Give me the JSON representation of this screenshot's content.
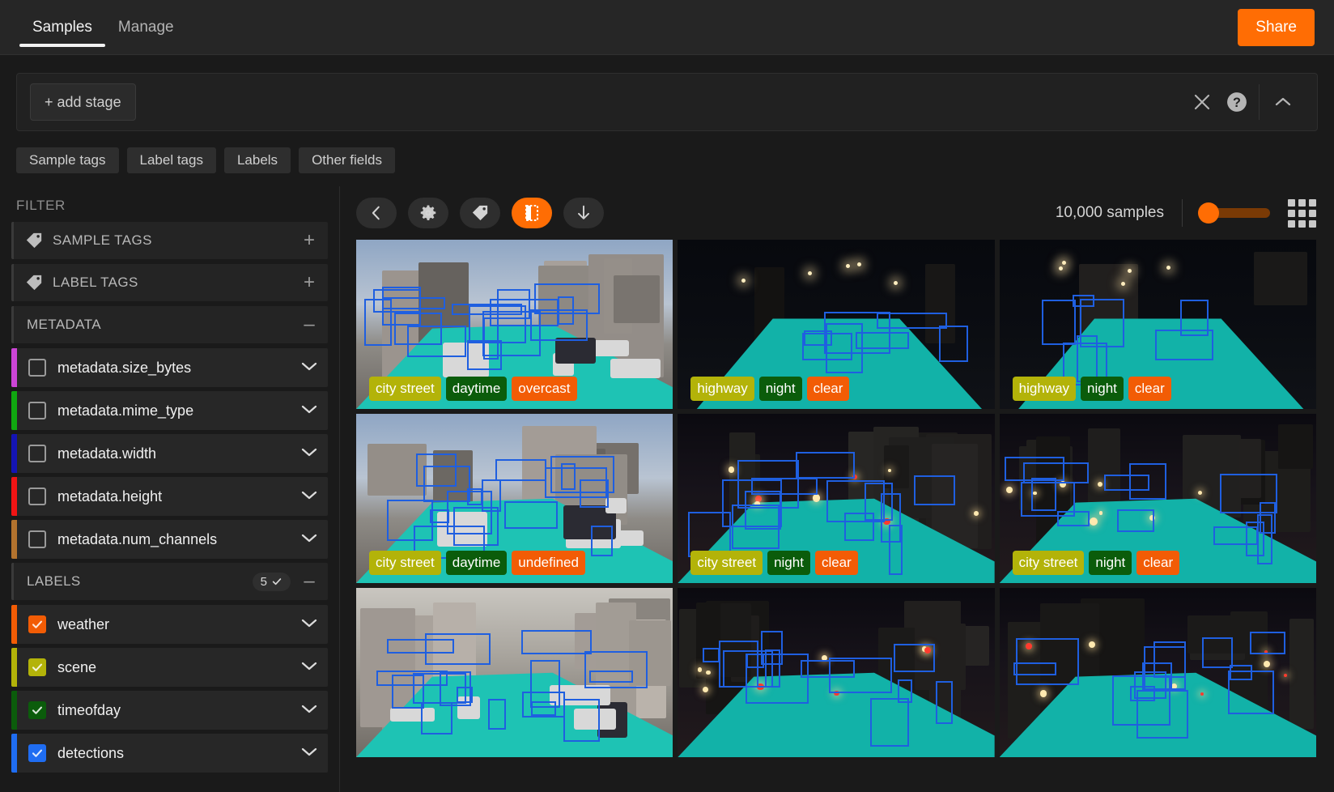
{
  "topnav": {
    "tabs": [
      {
        "label": "Samples",
        "active": true
      },
      {
        "label": "Manage",
        "active": false
      }
    ],
    "share_label": "Share"
  },
  "stagebar": {
    "add_stage_label": "+ add stage",
    "close_icon": "close-icon",
    "help_icon": "help-icon",
    "collapse_icon": "chevron-up-icon"
  },
  "fieldtabs": [
    {
      "label": "Sample tags"
    },
    {
      "label": "Label tags"
    },
    {
      "label": "Labels"
    },
    {
      "label": "Other fields"
    }
  ],
  "sidebar": {
    "title": "FILTER",
    "groups": [
      {
        "id": "sample-tags",
        "label": "SAMPLE TAGS",
        "icon": "tag-icon",
        "action": "+"
      },
      {
        "id": "label-tags",
        "label": "LABEL TAGS",
        "icon": "tag-icon",
        "action": "+"
      },
      {
        "id": "metadata",
        "label": "METADATA",
        "icon": null,
        "action": "–"
      }
    ],
    "metadata_fields": [
      {
        "label": "metadata.size_bytes",
        "color": "#cc45d6",
        "checked": false
      },
      {
        "label": "metadata.mime_type",
        "color": "#10a810",
        "checked": false
      },
      {
        "label": "metadata.width",
        "color": "#1414b4",
        "checked": false
      },
      {
        "label": "metadata.height",
        "color": "#f01414",
        "checked": false
      },
      {
        "label": "metadata.num_channels",
        "color": "#b3732e",
        "checked": false
      }
    ],
    "labels_group": {
      "label": "LABELS",
      "count": "5",
      "action": "–"
    },
    "label_fields": [
      {
        "label": "weather",
        "color": "#f25c05",
        "checked": true
      },
      {
        "label": "scene",
        "color": "#b3b309",
        "checked": true
      },
      {
        "label": "timeofday",
        "color": "#0b5c0b",
        "checked": true
      },
      {
        "label": "detections",
        "color": "#1f6df2",
        "checked": true
      }
    ]
  },
  "toolbar": {
    "buttons": [
      {
        "id": "back",
        "icon": "chevron-left-icon",
        "active": false
      },
      {
        "id": "settings",
        "icon": "gear-icon",
        "active": false
      },
      {
        "id": "tag",
        "icon": "tag-icon",
        "active": false
      },
      {
        "id": "selection",
        "icon": "selection-icon",
        "active": true
      },
      {
        "id": "download",
        "icon": "arrow-down-icon",
        "active": false
      }
    ],
    "samples_count": "10,000 samples",
    "zoom_slider_value": 0,
    "grid_icon": "grid-icon"
  },
  "tag_colors": {
    "scene": "#b3b309",
    "timeofday_day": "#0b5c0b",
    "timeofday_night": "#0b5c0b",
    "weather": "#f25c05"
  },
  "grid": {
    "samples": [
      {
        "id": "s1",
        "scene_kind": "city-day",
        "tags": [
          {
            "text": "city street",
            "type": "scene"
          },
          {
            "text": "daytime",
            "type": "timeofday"
          },
          {
            "text": "overcast",
            "type": "weather"
          }
        ]
      },
      {
        "id": "s2",
        "scene_kind": "highway-night",
        "tags": [
          {
            "text": "highway",
            "type": "scene"
          },
          {
            "text": "night",
            "type": "timeofday"
          },
          {
            "text": "clear",
            "type": "weather"
          }
        ]
      },
      {
        "id": "s3",
        "scene_kind": "highway-night2",
        "tags": [
          {
            "text": "highway",
            "type": "scene"
          },
          {
            "text": "night",
            "type": "timeofday"
          },
          {
            "text": "clear",
            "type": "weather"
          }
        ]
      },
      {
        "id": "s4",
        "scene_kind": "city-day2",
        "tags": [
          {
            "text": "city street",
            "type": "scene"
          },
          {
            "text": "daytime",
            "type": "timeofday"
          },
          {
            "text": "undefined",
            "type": "weather"
          }
        ]
      },
      {
        "id": "s5",
        "scene_kind": "city-night",
        "tags": [
          {
            "text": "city street",
            "type": "scene"
          },
          {
            "text": "night",
            "type": "timeofday"
          },
          {
            "text": "clear",
            "type": "weather"
          }
        ]
      },
      {
        "id": "s6",
        "scene_kind": "city-night2",
        "tags": [
          {
            "text": "city street",
            "type": "scene"
          },
          {
            "text": "night",
            "type": "timeofday"
          },
          {
            "text": "clear",
            "type": "weather"
          }
        ]
      },
      {
        "id": "s7",
        "scene_kind": "city-rain",
        "tags": []
      },
      {
        "id": "s8",
        "scene_kind": "city-night3",
        "tags": []
      },
      {
        "id": "s9",
        "scene_kind": "city-night4",
        "tags": []
      }
    ]
  }
}
